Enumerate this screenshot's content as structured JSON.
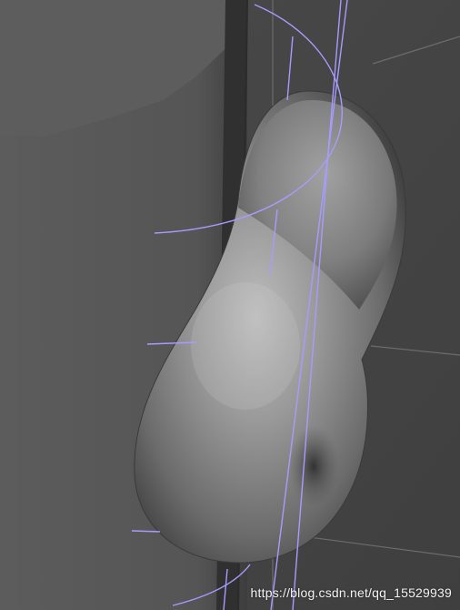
{
  "viewport": {
    "label": "3D modeling viewport",
    "object": "curved tube / pipe mesh",
    "curve_color": "#a89bff",
    "mesh_color": "#8f8f8f",
    "background_color": "#454545",
    "grid_color": "#6a6a6a"
  },
  "watermark": {
    "text": "https://blog.csdn.net/qq_15529939"
  }
}
